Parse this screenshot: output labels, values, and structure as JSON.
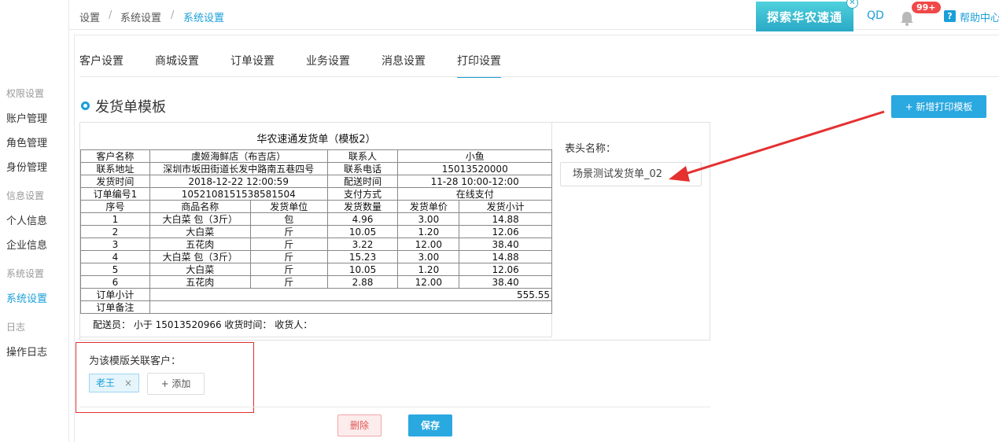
{
  "sidebar": {
    "group_permissions": "权限设置",
    "account_mgmt": "账户管理",
    "role_mgmt": "角色管理",
    "identity_mgmt": "身份管理",
    "group_info": "信息设置",
    "personal_info": "个人信息",
    "company_info": "企业信息",
    "group_system": "系统设置",
    "system_settings": "系统设置",
    "group_log": "日志",
    "operation_log": "操作日志"
  },
  "header": {
    "crumb1": "设置",
    "sep": "/",
    "crumb2": "系统设置",
    "crumb3": "系统设置",
    "banner": "探索华农速通",
    "user": "QD",
    "notifications": "99+",
    "help": "帮助中心"
  },
  "tabs": [
    "客户设置",
    "商城设置",
    "订单设置",
    "业务设置",
    "消息设置",
    "打印设置"
  ],
  "section_title": "发货单模板",
  "add_template_label": "+ 新增打印模板",
  "template": {
    "title": "华农速通发货单（模板2）",
    "labels": {
      "customer": "客户名称",
      "contact_person": "联系人",
      "address": "联系地址",
      "phone": "联系电话",
      "ship_time": "发货时间",
      "delivery_time": "配送时间",
      "order_no": "订单编号1",
      "pay_method": "支付方式",
      "col_no": "序号",
      "col_name": "商品名称",
      "col_unit": "发货单位",
      "col_qty": "发货数量",
      "col_price": "发货单价",
      "col_subtotal": "发货小计",
      "order_total": "订单小计",
      "order_note": "订单备注"
    },
    "values": {
      "customer": "虞姬海鲜店（布吉店）",
      "contact_person": "小鱼",
      "address": "深圳市坂田街道长发中路南五巷四号",
      "phone": "15013520000",
      "ship_time": "2018-12-22 12:00:59",
      "delivery_time": "11-28 10:00-12:00",
      "order_no": "105210815153858150​4",
      "pay_method": "在线支付",
      "order_total": "555.55"
    },
    "items": [
      {
        "no": "1",
        "name": "大白菜 包（3斤）",
        "unit": "包",
        "qty": "4.96",
        "price": "3.00",
        "subtotal": "14.88"
      },
      {
        "no": "2",
        "name": "大白菜",
        "unit": "斤",
        "qty": "10.05",
        "price": "1.20",
        "subtotal": "12.06"
      },
      {
        "no": "3",
        "name": "五花肉",
        "unit": "斤",
        "qty": "3.22",
        "price": "12.00",
        "subtotal": "38.40"
      },
      {
        "no": "4",
        "name": "大白菜 包（3斤）",
        "unit": "斤",
        "qty": "15.23",
        "price": "3.00",
        "subtotal": "14.88"
      },
      {
        "no": "5",
        "name": "大白菜",
        "unit": "斤",
        "qty": "10.05",
        "price": "1.20",
        "subtotal": "12.06"
      },
      {
        "no": "6",
        "name": "五花肉",
        "unit": "斤",
        "qty": "2.88",
        "price": "12.00",
        "subtotal": "38.40"
      }
    ],
    "footer": "配送员：  小于 15013520966   收货时间：            收货人："
  },
  "header_name_label": "表头名称：",
  "header_name_value": "场景测试发货单_02",
  "assoc_label": "为该模版关联客户：",
  "assoc_tag": "老王",
  "assoc_tag_close": "×",
  "assoc_add": "+ 添加",
  "delete_label": "删除",
  "save_label": "保存",
  "colors": {
    "accent": "#1a9fd9",
    "danger": "#e02f2f",
    "badge": "#f04848"
  }
}
